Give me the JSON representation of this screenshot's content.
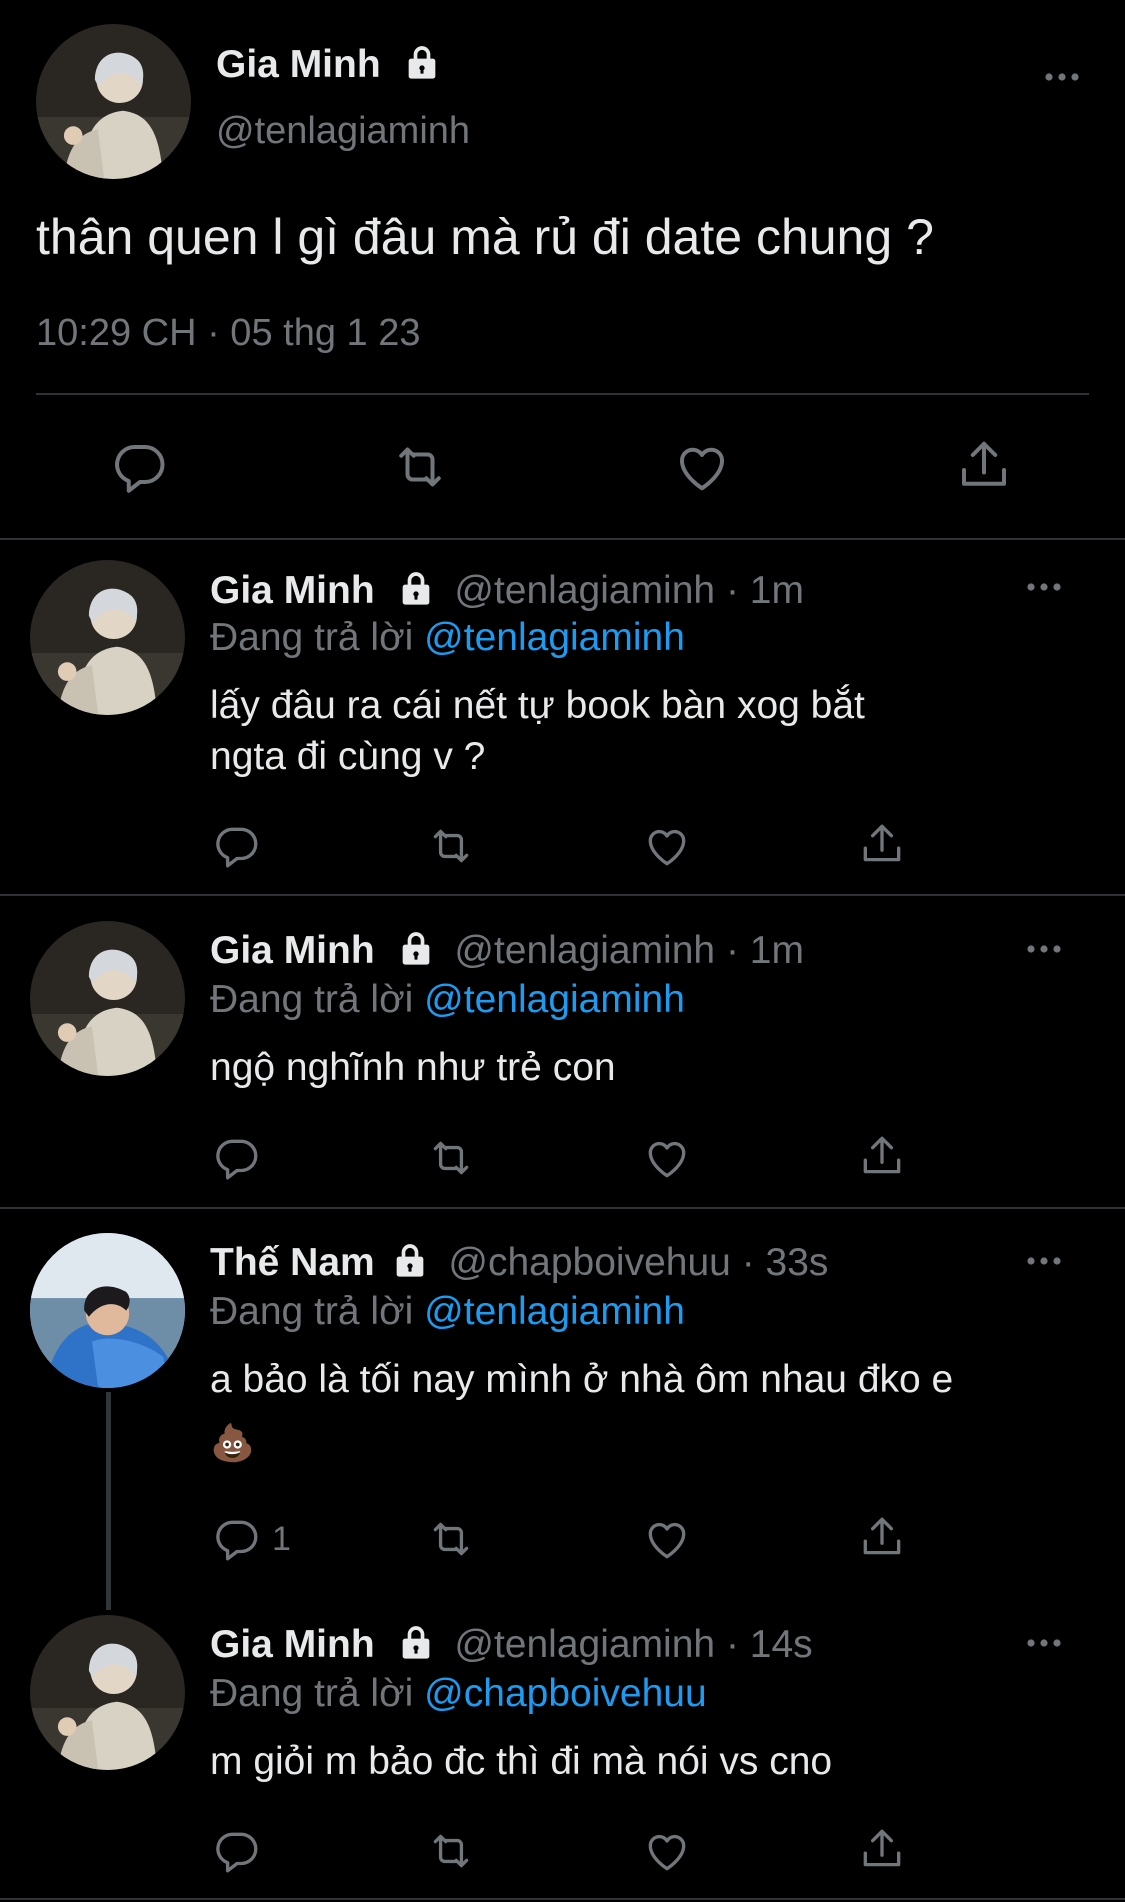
{
  "main_tweet": {
    "display_name": "Gia Minh",
    "handle": "@tenlagiaminh",
    "text": "thân quen l gì đâu mà rủ đi date chung ?",
    "timestamp": "10:29 CH · 05 thg 1 23",
    "icons": [
      "reply-icon",
      "retweet-icon",
      "like-icon",
      "share-icon",
      "more-icon",
      "lock-icon"
    ]
  },
  "replies": [
    {
      "display_name": "Gia Minh",
      "handle": "@tenlagiaminh",
      "time": "· 1m",
      "replying_prefix": "Đang trả lời",
      "replying_to": "@tenlagiaminh",
      "text_line1": "lấy đâu ra cái nết tự book bàn xog bắt",
      "text_line2": "ngta đi cùng v ?",
      "reply_count": ""
    },
    {
      "display_name": "Gia Minh",
      "handle": "@tenlagiaminh",
      "time": "· 1m",
      "replying_prefix": "Đang trả lời",
      "replying_to": "@tenlagiaminh",
      "text_line1": "ngộ nghĩnh như trẻ con",
      "text_line2": "",
      "reply_count": ""
    },
    {
      "display_name": "Thế Nam",
      "handle": "@chapboivehuu",
      "time": "· 33s",
      "replying_prefix": "Đang trả lời",
      "replying_to": "@tenlagiaminh",
      "text_line1": "a bảo là tối nay mình ở nhà ôm nhau đko e",
      "text_line2": "💩",
      "reply_count": "1"
    },
    {
      "display_name": "Gia Minh",
      "handle": "@tenlagiaminh",
      "time": "· 14s",
      "replying_prefix": "Đang trả lời",
      "replying_to": "@chapboivehuu",
      "text_line1": "m giỏi m bảo đc thì đi mà nói vs cno",
      "text_line2": "",
      "reply_count": ""
    }
  ],
  "colors": {
    "background": "#000000",
    "text": "#e7e9ea",
    "muted": "#71767b",
    "link": "#1d9bf0",
    "divider": "#2f3336"
  }
}
